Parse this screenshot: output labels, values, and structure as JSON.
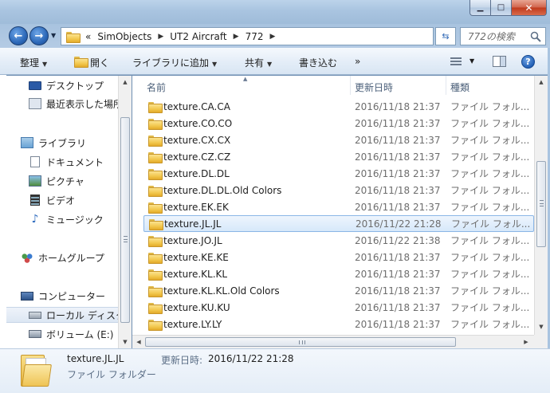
{
  "window": {
    "title": "",
    "minimize_glyph": "▁",
    "maximize_glyph": "□",
    "close_glyph": "✕"
  },
  "address": {
    "overflow": "«",
    "crumbs": [
      "SimObjects",
      "UT2 Aircraft",
      "772"
    ],
    "search_placeholder": "772の検索"
  },
  "toolbar": {
    "organize": "整理",
    "open": "開く",
    "add_to_library": "ライブラリに追加",
    "share": "共有",
    "burn": "書き込む",
    "more": "»",
    "help": "?"
  },
  "nav": {
    "items": [
      {
        "label": "デスクトップ",
        "icon": "desktop-icon"
      },
      {
        "label": "最近表示した場所",
        "icon": "recent-places-icon"
      },
      {
        "label": "ライブラリ",
        "icon": "library-icon"
      },
      {
        "label": "ドキュメント",
        "icon": "documents-icon"
      },
      {
        "label": "ピクチャ",
        "icon": "pictures-icon"
      },
      {
        "label": "ビデオ",
        "icon": "videos-icon"
      },
      {
        "label": "ミュージック",
        "icon": "music-icon"
      },
      {
        "label": "ホームグループ",
        "icon": "homegroup-icon"
      },
      {
        "label": "コンピューター",
        "icon": "computer-icon"
      },
      {
        "label": "ローカル ディスク",
        "icon": "local-disk-icon"
      },
      {
        "label": "ボリューム (E:)",
        "icon": "volume-icon"
      }
    ]
  },
  "columns": {
    "name": "名前",
    "date": "更新日時",
    "type": "種類"
  },
  "files": [
    {
      "name": "texture.CA.CA",
      "date": "2016/11/18 21:37",
      "type": "ファイル フォル..."
    },
    {
      "name": "texture.CO.CO",
      "date": "2016/11/18 21:37",
      "type": "ファイル フォル..."
    },
    {
      "name": "texture.CX.CX",
      "date": "2016/11/18 21:37",
      "type": "ファイル フォル..."
    },
    {
      "name": "texture.CZ.CZ",
      "date": "2016/11/18 21:37",
      "type": "ファイル フォル..."
    },
    {
      "name": "texture.DL.DL",
      "date": "2016/11/18 21:37",
      "type": "ファイル フォル..."
    },
    {
      "name": "texture.DL.DL.Old Colors",
      "date": "2016/11/18 21:37",
      "type": "ファイル フォル..."
    },
    {
      "name": "texture.EK.EK",
      "date": "2016/11/18 21:37",
      "type": "ファイル フォル..."
    },
    {
      "name": "texture.JL.JL",
      "date": "2016/11/22 21:28",
      "type": "ファイル フォル..."
    },
    {
      "name": "texture.JO.JL",
      "date": "2016/11/22 21:38",
      "type": "ファイル フォル..."
    },
    {
      "name": "texture.KE.KE",
      "date": "2016/11/18 21:37",
      "type": "ファイル フォル..."
    },
    {
      "name": "texture.KL.KL",
      "date": "2016/11/18 21:37",
      "type": "ファイル フォル..."
    },
    {
      "name": "texture.KL.KL.Old Colors",
      "date": "2016/11/18 21:37",
      "type": "ファイル フォル..."
    },
    {
      "name": "texture.KU.KU",
      "date": "2016/11/18 21:37",
      "type": "ファイル フォル..."
    },
    {
      "name": "texture.LY.LY",
      "date": "2016/11/18 21:37",
      "type": "ファイル フォル..."
    }
  ],
  "details": {
    "name": "texture.JL.JL",
    "date_label": "更新日時:",
    "date": "2016/11/22 21:28",
    "type": "ファイル フォルダー"
  },
  "colors": {
    "selection_border": "#8ab6e6",
    "window_frame": "#a9c4e0",
    "folder": "#f2c74c"
  }
}
